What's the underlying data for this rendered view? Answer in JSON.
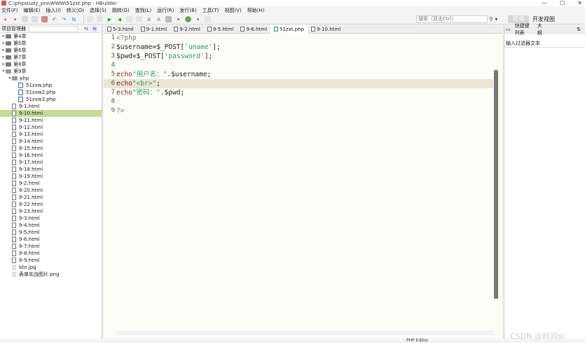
{
  "window": {
    "title": "C:\\phpstudy_pro\\WWW\\51zxt.php - HBuilder",
    "controls": [
      "—",
      "☐",
      "✕"
    ]
  },
  "menu": [
    "文件(F)",
    "编辑(E)",
    "插入(I)",
    "转义(O)",
    "选择(S)",
    "跳转(G)",
    "查找(L)",
    "运行(R)",
    "发行(B)",
    "工具(T)",
    "视图(V)",
    "帮助(H)"
  ],
  "toolbar": {
    "search_placeholder": "搜索（双击Ctrl）",
    "search_icon": "search-icon",
    "view_button": "视 图",
    "view_label": "开发视图"
  },
  "project_panel": {
    "title": "项目管理器",
    "items": [
      {
        "label": "第4章",
        "type": "folder",
        "depth": 0,
        "expanded": false
      },
      {
        "label": "第5章",
        "type": "folder",
        "depth": 0,
        "expanded": false
      },
      {
        "label": "第6章",
        "type": "folder",
        "depth": 0,
        "expanded": false
      },
      {
        "label": "第7章",
        "type": "folder",
        "depth": 0,
        "expanded": false
      },
      {
        "label": "第8章",
        "type": "folder",
        "depth": 0,
        "expanded": false
      },
      {
        "label": "第9章",
        "type": "folder",
        "depth": 0,
        "expanded": true
      },
      {
        "label": "php",
        "type": "folder",
        "depth": 1,
        "expanded": true
      },
      {
        "label": "51zxw.php",
        "type": "php",
        "depth": 2
      },
      {
        "label": "51zxw2.php",
        "type": "php",
        "depth": 2
      },
      {
        "label": "51zxw3.php",
        "type": "php",
        "depth": 2
      },
      {
        "label": "9-1.html",
        "type": "html",
        "depth": 1
      },
      {
        "label": "9-10.html",
        "type": "html",
        "depth": 1,
        "selected": true
      },
      {
        "label": "9-11.html",
        "type": "html",
        "depth": 1
      },
      {
        "label": "9-12.html",
        "type": "html",
        "depth": 1
      },
      {
        "label": "9-13.html",
        "type": "html",
        "depth": 1
      },
      {
        "label": "9-14.html",
        "type": "html",
        "depth": 1
      },
      {
        "label": "9-15.html",
        "type": "html",
        "depth": 1
      },
      {
        "label": "9-16.html",
        "type": "html",
        "depth": 1
      },
      {
        "label": "9-17.html",
        "type": "html",
        "depth": 1
      },
      {
        "label": "9-18.html",
        "type": "html",
        "depth": 1
      },
      {
        "label": "9-19.html",
        "type": "html",
        "depth": 1
      },
      {
        "label": "9-2.html",
        "type": "html",
        "depth": 1
      },
      {
        "label": "9-20.html",
        "type": "html",
        "depth": 1
      },
      {
        "label": "9-21.html",
        "type": "html",
        "depth": 1
      },
      {
        "label": "9-22.html",
        "type": "html",
        "depth": 1
      },
      {
        "label": "9-23.html",
        "type": "html",
        "depth": 1
      },
      {
        "label": "9-3.html",
        "type": "html",
        "depth": 1
      },
      {
        "label": "9-4.html",
        "type": "html",
        "depth": 1
      },
      {
        "label": "9-5.html",
        "type": "html",
        "depth": 1
      },
      {
        "label": "9-6.html",
        "type": "html",
        "depth": 1
      },
      {
        "label": "9-7.html",
        "type": "html",
        "depth": 1
      },
      {
        "label": "9-8.html",
        "type": "html",
        "depth": 1
      },
      {
        "label": "9-9.html",
        "type": "html",
        "depth": 1
      },
      {
        "label": "btn.jpg",
        "type": "img",
        "depth": 1
      },
      {
        "label": "表单实战图片.png",
        "type": "img",
        "depth": 1
      }
    ]
  },
  "editor": {
    "tabs": [
      {
        "label": "5-3.html",
        "type": "html"
      },
      {
        "label": "9-1.html",
        "type": "html"
      },
      {
        "label": "9-2.html",
        "type": "html"
      },
      {
        "label": "9-5.html",
        "type": "html"
      },
      {
        "label": "9-6.html",
        "type": "html"
      },
      {
        "label": "51zxt.php",
        "type": "php",
        "active": true
      },
      {
        "label": "9-10.html",
        "type": "html"
      }
    ],
    "current_line": 6,
    "lines": [
      {
        "n": "1",
        "parts": [
          {
            "t": "<?php",
            "c": "gray"
          }
        ]
      },
      {
        "n": "2",
        "parts": [
          {
            "t": "$username=$_POST[",
            "c": "op"
          },
          {
            "t": "'uname'",
            "c": "str"
          },
          {
            "t": "];",
            "c": "op"
          }
        ]
      },
      {
        "n": "3",
        "parts": [
          {
            "t": "$pwd=$_POST[",
            "c": "op"
          },
          {
            "t": "'password'",
            "c": "str"
          },
          {
            "t": "];",
            "c": "op"
          }
        ]
      },
      {
        "n": "4",
        "parts": []
      },
      {
        "n": "5",
        "parts": [
          {
            "t": "echo",
            "c": "kw"
          },
          {
            "t": "\"用户名：\"",
            "c": "str"
          },
          {
            "t": ".$username;",
            "c": "op"
          }
        ]
      },
      {
        "n": "6",
        "parts": [
          {
            "t": "echo",
            "c": "kw"
          },
          {
            "t": "\"<br>\"",
            "c": "str"
          },
          {
            "t": ";",
            "c": "op"
          }
        ]
      },
      {
        "n": "7",
        "parts": [
          {
            "t": "echo",
            "c": "kw"
          },
          {
            "t": "\"密码：\"",
            "c": "str"
          },
          {
            "t": ".$pwd;",
            "c": "op"
          }
        ]
      },
      {
        "n": "8",
        "parts": []
      },
      {
        "n": "9",
        "parts": [
          {
            "t": "?>",
            "c": "gray"
          }
        ]
      }
    ]
  },
  "right_panel": {
    "tabs": [
      "快捷键列表",
      "大纲"
    ],
    "filter_placeholder": "输入过滤器文本"
  },
  "status": {
    "editor_type": "PHP Editor",
    "watermark": "CSDN @时间si"
  }
}
